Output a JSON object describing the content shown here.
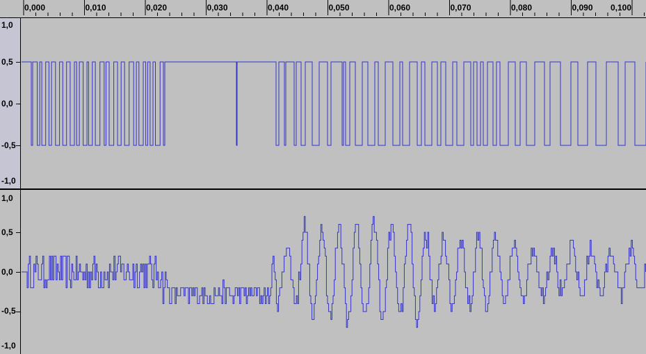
{
  "ruler": {
    "ticks": [
      "0,000",
      "0,010",
      "0,020",
      "0,030",
      "0,040",
      "0,050",
      "0,060",
      "0,070",
      "0,080",
      "0,090",
      "0,100"
    ]
  },
  "tracks": [
    {
      "scale_labels": [
        "1,0",
        "0,5",
        "0,0",
        "-0,5",
        "-1,0"
      ],
      "waveform": "digital square wave (±0.5)"
    },
    {
      "scale_labels": [
        "1,0",
        "0,5",
        "0,0",
        "-0,5",
        "-1,0"
      ],
      "waveform": "filtered stepped analog signal"
    }
  ],
  "colors": {
    "waveform": "#3232c8",
    "background": "#c0c0c0",
    "selected_ruler": "#c5c5d3"
  }
}
